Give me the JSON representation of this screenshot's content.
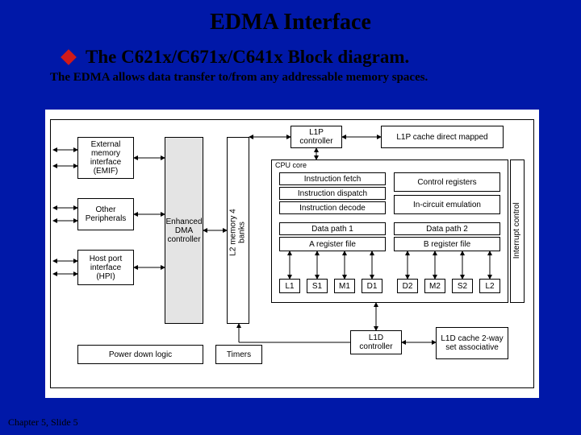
{
  "title": "EDMA Interface",
  "subtitle": "The C621x/C671x/C641x Block diagram.",
  "caption": "The EDMA allows data transfer to/from any addressable memory spaces.",
  "footer": "Chapter 5, Slide 5",
  "blocks": {
    "emif": "External\nmemory\ninterface\n(EMIF)",
    "other": "Other\nPeripherals",
    "hpi": "Host port\ninterface\n(HPI)",
    "edma": "Enhanced\nDMA\ncontroller",
    "l2": "L2 memory\n4 banks",
    "pdl": "Power down logic",
    "timers": "Timers",
    "l1pctrl": "L1P\ncontroller",
    "l1pcache": "L1P cache direct mapped",
    "cpu": "CPU core",
    "ifetch": "Instruction fetch",
    "idisp": "Instruction dispatch",
    "idec": "Instruction decode",
    "creg": "Control registers",
    "ice": "In-circuit emulation",
    "dp1": "Data path 1",
    "dp2": "Data path 2",
    "areg": "A register file",
    "breg": "B register file",
    "l1": "L1",
    "s1": "S1",
    "m1": "M1",
    "d1": "D1",
    "d2": "D2",
    "m2": "M2",
    "s2": "S2",
    "l2u": "L2",
    "intc": "Interrupt control",
    "l1dctrl": "L1D\ncontroller",
    "l1dcache": "L1D cache\n2-way set\nassociative"
  }
}
